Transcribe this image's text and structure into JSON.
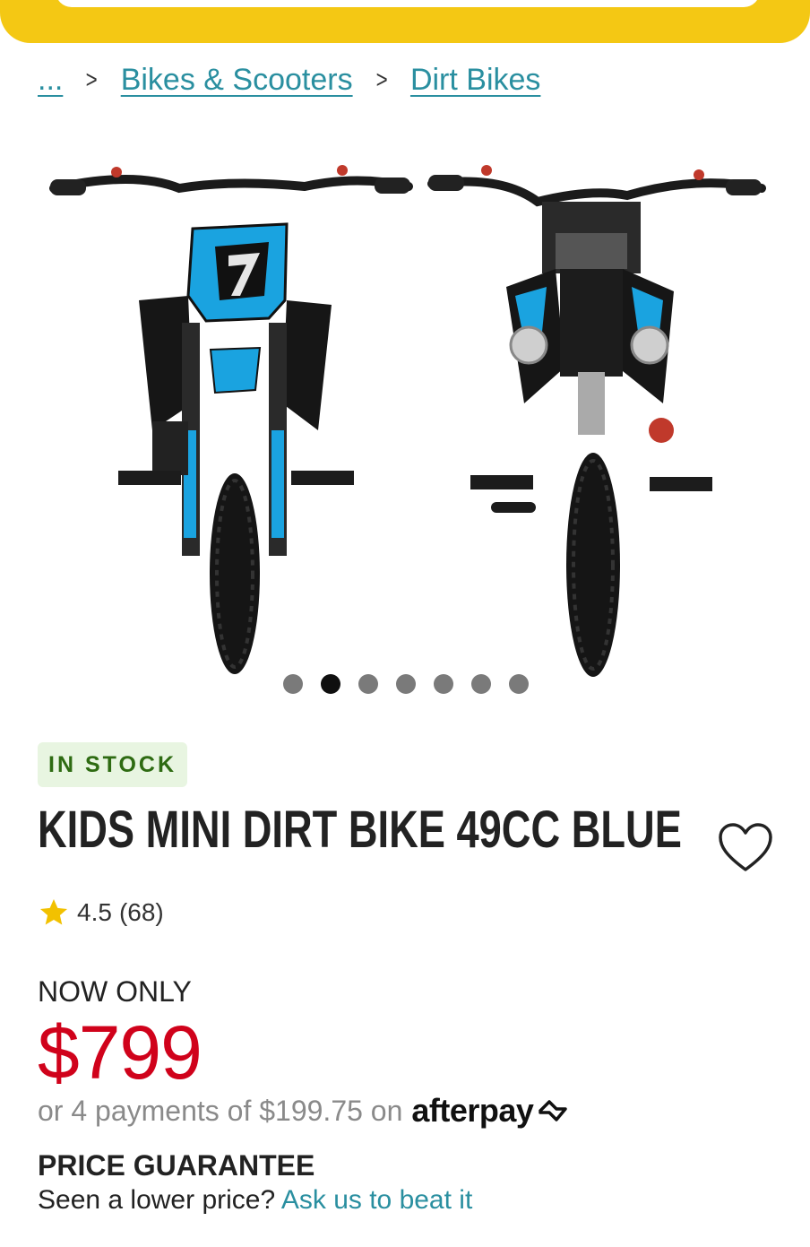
{
  "breadcrumb": {
    "ellipsis": "...",
    "separator": ">",
    "items": [
      {
        "label": "Bikes & Scooters"
      },
      {
        "label": "Dirt Bikes"
      }
    ]
  },
  "gallery": {
    "dot_count": 7,
    "active_index": 1,
    "bike_color": "#1aa3e0"
  },
  "product": {
    "stock_status": "IN STOCK",
    "title": "KIDS MINI DIRT BIKE 49CC BLUE",
    "rating": "4.5",
    "review_count": "(68)",
    "price_label": "NOW ONLY",
    "price": "$799",
    "installments_prefix": "or 4 payments of $199.75 on",
    "afterpay_brand": "afterpay"
  },
  "guarantee": {
    "title": "PRICE GUARANTEE",
    "text": "Seen a lower price?",
    "link": "Ask us to beat it"
  },
  "colors": {
    "banner": "#f4c814",
    "link": "#2a8fa0",
    "price": "#d0021b",
    "stock_green": "#2e6b12",
    "stock_bg": "#e8f5e1",
    "star": "#f2c100"
  },
  "icons": [
    "heart-icon",
    "star-icon",
    "afterpay-icon",
    "chevron-right-icon"
  ]
}
